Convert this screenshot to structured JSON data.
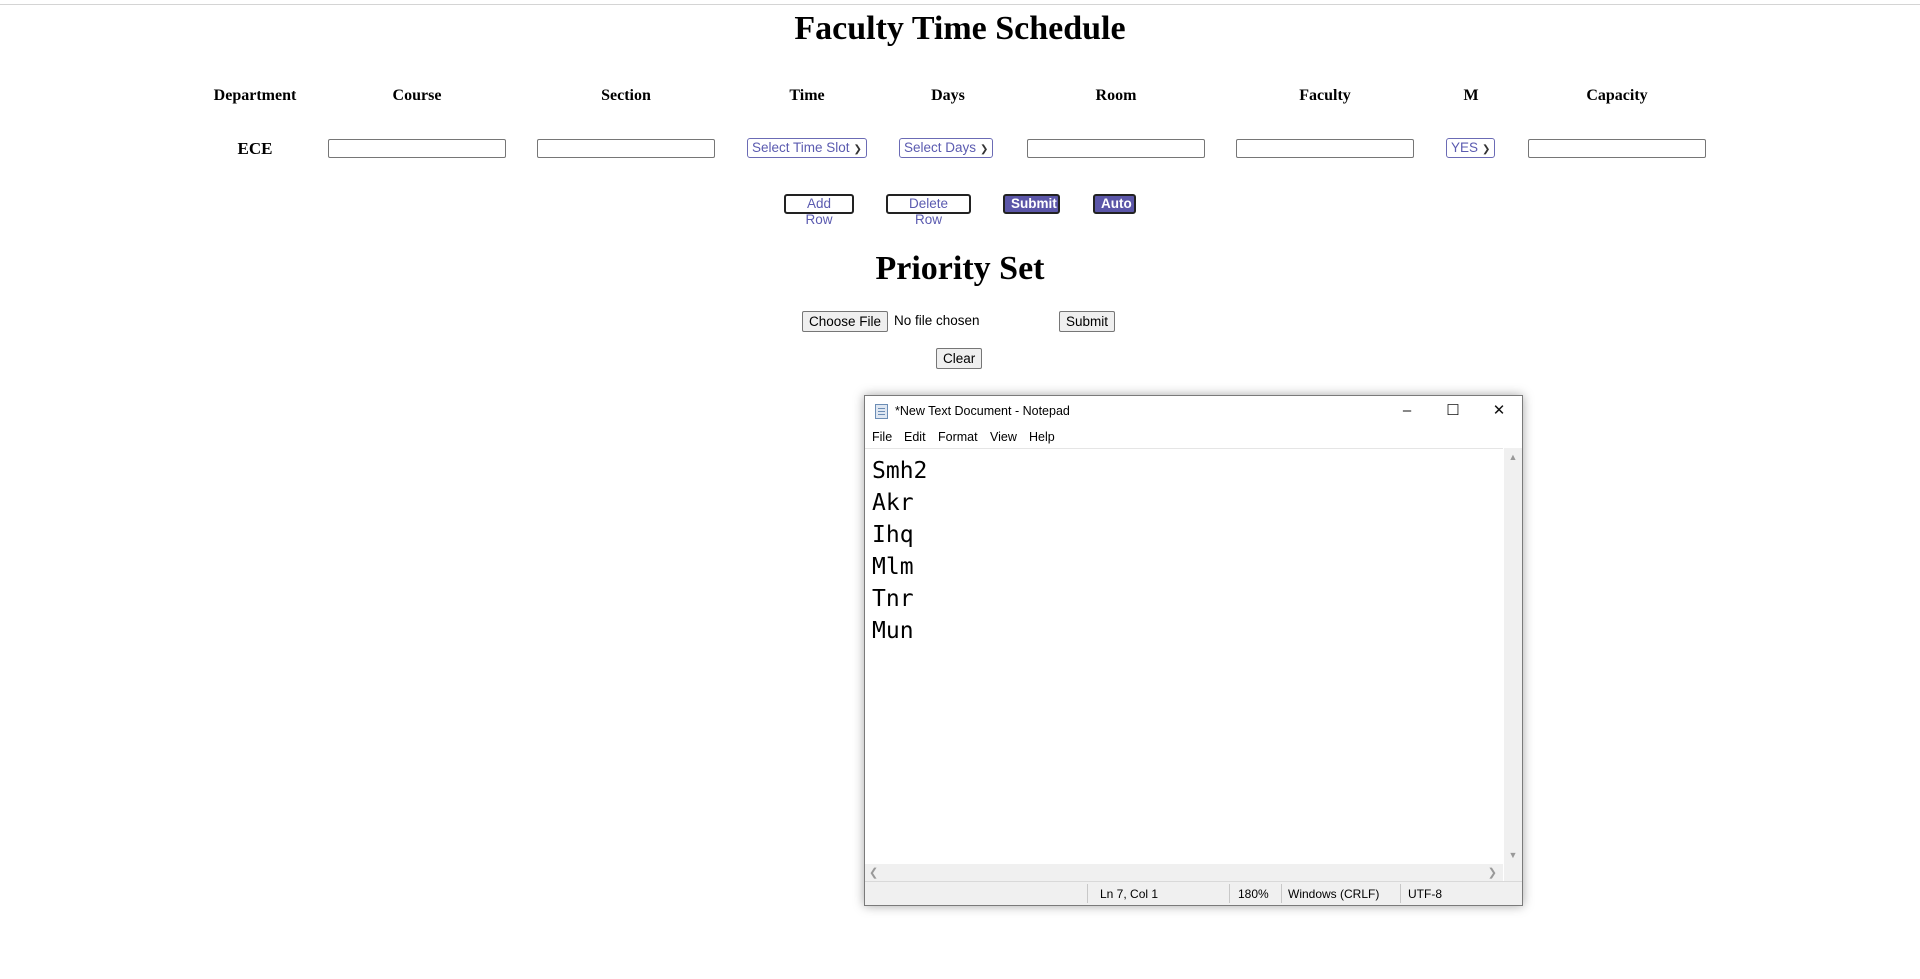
{
  "page": {
    "title": "Faculty Time Schedule",
    "columns": [
      "Department",
      "Course",
      "Section",
      "Time",
      "Days",
      "Room",
      "Faculty",
      "M",
      "Capacity"
    ],
    "row": {
      "department": "ECE",
      "course": "",
      "section": "",
      "time_select": "Select Time Slot",
      "days_select": "Select Days",
      "room": "",
      "faculty": "",
      "m_select": "YES",
      "capacity": ""
    },
    "buttons": {
      "add_row": "Add Row",
      "delete_row": "Delete Row",
      "submit": "Submit",
      "auto": "Auto"
    },
    "priority": {
      "title": "Priority Set",
      "choose_file": "Choose File",
      "file_status": "No file chosen",
      "submit": "Submit",
      "clear": "Clear"
    },
    "accent_color": "#5b56a8"
  },
  "notepad": {
    "title": "*New Text Document - Notepad",
    "menu": [
      "File",
      "Edit",
      "Format",
      "View",
      "Help"
    ],
    "lines": [
      "Smh2",
      "Akr",
      "Ihq",
      "Mlm",
      "Tnr",
      "Mun"
    ],
    "status": {
      "position": "Ln 7, Col 1",
      "zoom": "180%",
      "line_ending": "Windows (CRLF)",
      "encoding": "UTF-8"
    },
    "icons": [
      "notepad-icon",
      "minimize-icon",
      "maximize-icon",
      "close-icon"
    ]
  }
}
